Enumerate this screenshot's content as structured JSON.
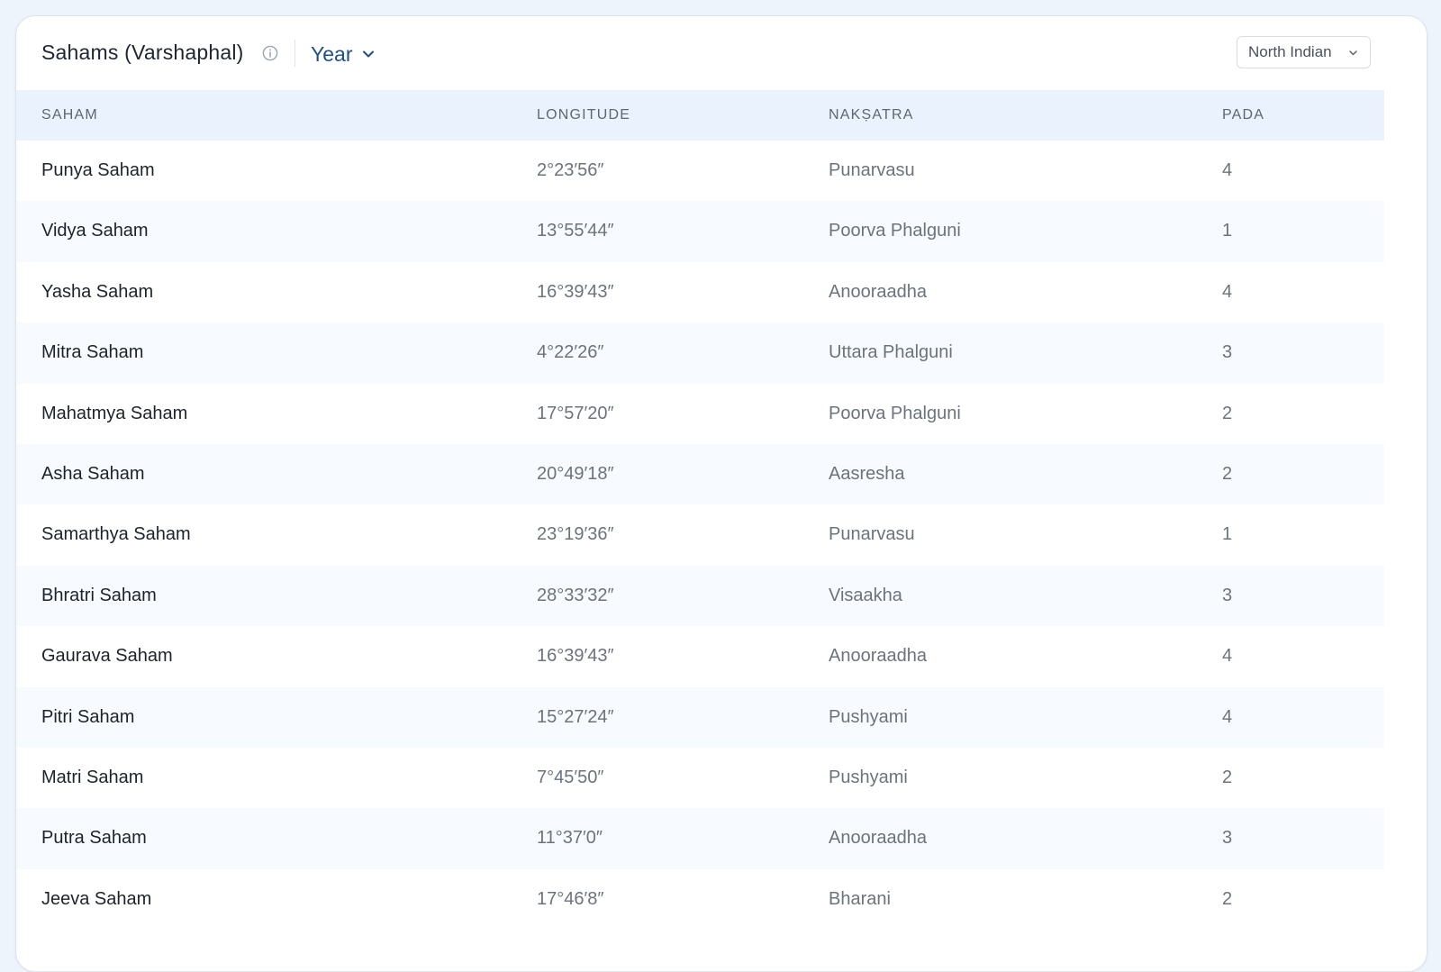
{
  "header": {
    "title": "Sahams (Varshaphal)",
    "info_icon": "info-circle-icon",
    "period_select": {
      "value": "Year",
      "icon": "chevron-down-icon"
    },
    "chart_style_select": {
      "value": "North Indian",
      "icon": "chevron-down-icon"
    }
  },
  "table": {
    "columns": [
      "SAHAM",
      "LONGITUDE",
      "NAKṢATRA",
      "PADA"
    ],
    "rows": [
      {
        "saham": "Punya Saham",
        "longitude": "2°23′56″",
        "nakshatra": "Punarvasu",
        "pada": "4"
      },
      {
        "saham": "Vidya Saham",
        "longitude": "13°55′44″",
        "nakshatra": "Poorva Phalguni",
        "pada": "1"
      },
      {
        "saham": "Yasha Saham",
        "longitude": "16°39′43″",
        "nakshatra": "Anooraadha",
        "pada": "4"
      },
      {
        "saham": "Mitra Saham",
        "longitude": "4°22′26″",
        "nakshatra": "Uttara Phalguni",
        "pada": "3"
      },
      {
        "saham": "Mahatmya Saham",
        "longitude": "17°57′20″",
        "nakshatra": "Poorva Phalguni",
        "pada": "2"
      },
      {
        "saham": "Asha Saham",
        "longitude": "20°49′18″",
        "nakshatra": "Aasresha",
        "pada": "2"
      },
      {
        "saham": "Samarthya Saham",
        "longitude": "23°19′36″",
        "nakshatra": "Punarvasu",
        "pada": "1"
      },
      {
        "saham": "Bhratri Saham",
        "longitude": "28°33′32″",
        "nakshatra": "Visaakha",
        "pada": "3"
      },
      {
        "saham": "Gaurava Saham",
        "longitude": "16°39′43″",
        "nakshatra": "Anooraadha",
        "pada": "4"
      },
      {
        "saham": "Pitri Saham",
        "longitude": "15°27′24″",
        "nakshatra": "Pushyami",
        "pada": "4"
      },
      {
        "saham": "Matri Saham",
        "longitude": "7°45′50″",
        "nakshatra": "Pushyami",
        "pada": "2"
      },
      {
        "saham": "Putra Saham",
        "longitude": "11°37′0″",
        "nakshatra": "Anooraadha",
        "pada": "3"
      },
      {
        "saham": "Jeeva Saham",
        "longitude": "17°46′8″",
        "nakshatra": "Bharani",
        "pada": "2"
      }
    ]
  }
}
